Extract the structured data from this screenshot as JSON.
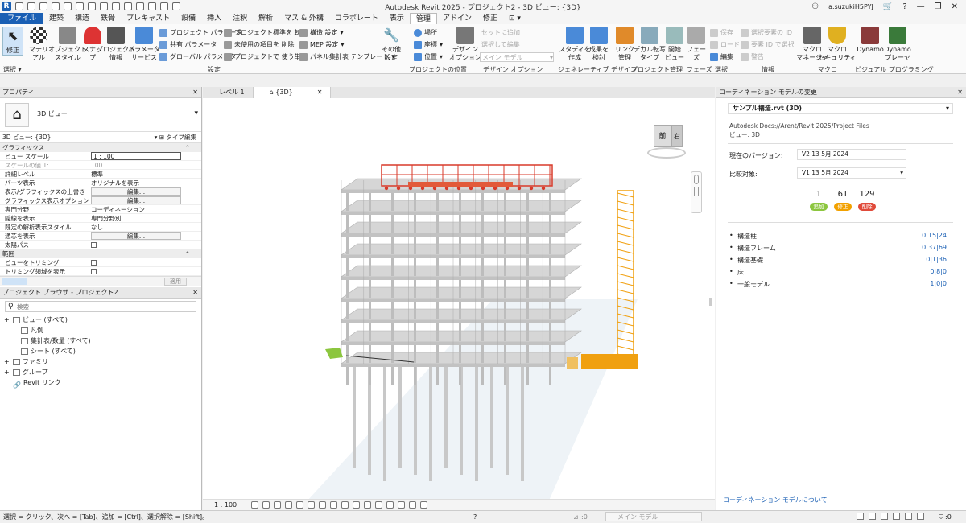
{
  "title": "Autodesk Revit 2025 - プロジェクト2 - 3D ビュー: {3D}",
  "user": "a.suzukiH5PYJ",
  "menu": [
    "ファイル",
    "建築",
    "構造",
    "鉄骨",
    "プレキャスト",
    "設備",
    "挿入",
    "注釈",
    "解析",
    "マス & 外構",
    "コラボレート",
    "表示",
    "管理",
    "アドイン",
    "修正"
  ],
  "menu_active": "管理",
  "ribbon": {
    "modify": "修正",
    "material": "マテリアル",
    "object_style": "オブジェクト\nスタイル",
    "snap": "スナップ",
    "project_info": "プロジェクト\n情報",
    "param_service": "パラメータ\nサービス",
    "project_params": "プロジェクト パラメータ",
    "shared_params": "共有 パラメータ",
    "global_params": "グローバル パラメータ",
    "transfer_standards": "プロジェクト標準を 転送",
    "purge_unused": "未使用の項目を 削除",
    "project_units": "プロジェクトで 使う単位",
    "structural_settings": "構造 設定",
    "mep_settings": "MEP 設定",
    "panel_schedule_templates": "パネル集計表 テンプレート",
    "other_settings": "その他\n設定",
    "location": "場所",
    "coordinates": "座標",
    "position": "位置",
    "design_options": "デザイン\nオプション",
    "add_to_set": "セットに追加",
    "pick_to_edit": "選択して編集",
    "main_model": "メイン モデル",
    "study_create": "スタディを\n作成",
    "explore_outcomes": "成果を\n検討",
    "manage_links": "リンク\n管理",
    "decal_types": "デカル転写\nタイプ",
    "starting_view": "開始\nビュー",
    "phases": "フェーズ",
    "edit": "編集",
    "select_by_id": "選択",
    "load": "ロード",
    "save": "保存",
    "selection_elements": "選択要素の ID",
    "select_by_id2": "要素 ID で選択",
    "warnings": "警告",
    "macro_manager": "マクロ\nマネージャ",
    "macro_security": "マクロ\nセキュリティ",
    "dynamo": "Dynamo",
    "dynamo_player": "Dynamo\nプレーヤ"
  },
  "panels": [
    "選択 ▾",
    "設定",
    "プロジェクトの位置",
    "デザイン オプション",
    "ジェネレーティブ デザイン",
    "プロジェクト管理",
    "フェーズ",
    "選択",
    "情報",
    "マクロ",
    "ビジュアル プログラミング"
  ],
  "properties": {
    "header": "プロパティ",
    "type_name": "3D ビュー",
    "instance_label": "3D ビュー: {3D}",
    "type_edit": "タイプ編集",
    "cat_graphics": "グラフィックス",
    "rows": [
      {
        "k": "ビュー スケール",
        "v": "1 : 100",
        "kind": "input"
      },
      {
        "k": "スケールの値  1:",
        "v": "100",
        "kind": "dim"
      },
      {
        "k": "詳細レベル",
        "v": "標準",
        "kind": "text"
      },
      {
        "k": "パーツ表示",
        "v": "オリジナルを表示",
        "kind": "text"
      },
      {
        "k": "表示/グラフィックスの上書き",
        "v": "編集...",
        "kind": "btn"
      },
      {
        "k": "グラフィックス表示オプション",
        "v": "編集...",
        "kind": "btn"
      },
      {
        "k": "専門分野",
        "v": "コーディネーション",
        "kind": "text"
      },
      {
        "k": "隠線を表示",
        "v": "専門分野別",
        "kind": "text"
      },
      {
        "k": "既定の解析表示スタイル",
        "v": "なし",
        "kind": "text"
      },
      {
        "k": "通芯を表示",
        "v": "編集...",
        "kind": "btn"
      },
      {
        "k": "太陽パス",
        "v": "",
        "kind": "chk"
      }
    ],
    "cat_range": "範囲",
    "rows2": [
      {
        "k": "ビューをトリミング",
        "v": "",
        "kind": "chk"
      },
      {
        "k": "トリミング領域を表示",
        "v": "",
        "kind": "chk"
      }
    ],
    "apply": "適用"
  },
  "browser": {
    "header": "プロジェクト ブラウザ - プロジェクト2",
    "search_placeholder": "検索",
    "items": [
      "ビュー (すべて)",
      "凡例",
      "集計表/数量 (すべて)",
      "シート (すべて)",
      "ファミリ",
      "グループ",
      "Revit リンク"
    ]
  },
  "view_tabs": [
    "レベル 1",
    "{3D}"
  ],
  "viewcube": {
    "front": "前",
    "right": "右"
  },
  "view_scale": "1 : 100",
  "coord": {
    "header": "コーディネーション モデルの変更",
    "model": "サンプル構造.rvt (3D)",
    "path": "Autodesk Docs://Arent/Revit 2025/Project Files",
    "view": "ビュー: 3D",
    "current_label": "現在のバージョン:",
    "current_value": "V2 13 5月 2024",
    "compare_label": "比較対象:",
    "compare_value": "V1 13 5月 2024",
    "counts": [
      {
        "n": "1",
        "label": "追加",
        "color": "#8cc63f"
      },
      {
        "n": "61",
        "label": "修正",
        "color": "#f2a100"
      },
      {
        "n": "129",
        "label": "削除",
        "color": "#e04a3a"
      }
    ],
    "items": [
      {
        "label": "構造柱",
        "value": "0|15|24"
      },
      {
        "label": "構造フレーム",
        "value": "0|37|69"
      },
      {
        "label": "構造基礎",
        "value": "0|1|36"
      },
      {
        "label": "床",
        "value": "0|8|0"
      },
      {
        "label": "一般モデル",
        "value": "1|0|0"
      }
    ],
    "about_link": "コーディネーション モデルについて"
  },
  "status": {
    "hint": "選択 = クリック、次へ = [Tab]、追加 = [Ctrl]、選択解除 = [Shift]。",
    "count": ":0",
    "model": "メイン モデル",
    "filter": ":0"
  }
}
